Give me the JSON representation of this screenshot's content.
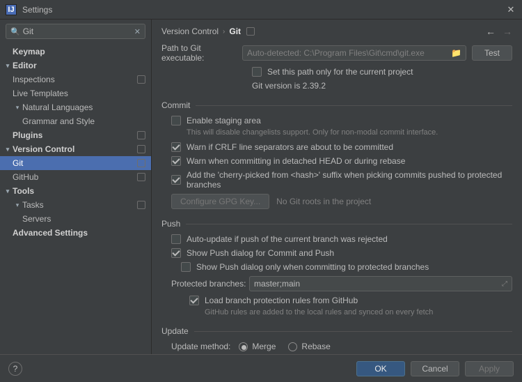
{
  "window": {
    "app_icon_text": "IJ",
    "title": "Settings"
  },
  "search": {
    "value": "Git"
  },
  "tree": [
    {
      "label": "Keymap",
      "level": 0,
      "expandable": false,
      "marker": false
    },
    {
      "label": "Editor",
      "level": 0,
      "expandable": true,
      "chev": "▾",
      "marker": false
    },
    {
      "label": "Inspections",
      "level": 1,
      "marker": true
    },
    {
      "label": "Live Templates",
      "level": 1,
      "marker": false
    },
    {
      "label": "Natural Languages",
      "level": 1,
      "expandable": true,
      "chev": "▾",
      "marker": false
    },
    {
      "label": "Grammar and Style",
      "level": 2,
      "marker": false
    },
    {
      "label": "Plugins",
      "level": 0,
      "expandable": false,
      "marker": true
    },
    {
      "label": "Version Control",
      "level": 0,
      "expandable": true,
      "chev": "▾",
      "marker": true
    },
    {
      "label": "Git",
      "level": 1,
      "selected": true,
      "marker": true
    },
    {
      "label": "GitHub",
      "level": 1,
      "marker": true
    },
    {
      "label": "Tools",
      "level": 0,
      "expandable": true,
      "chev": "▾",
      "marker": false
    },
    {
      "label": "Tasks",
      "level": 1,
      "expandable": true,
      "chev": "▾",
      "marker": true
    },
    {
      "label": "Servers",
      "level": 2,
      "marker": false
    },
    {
      "label": "Advanced Settings",
      "level": 0,
      "expandable": false,
      "marker": false
    }
  ],
  "breadcrumb": {
    "parent": "Version Control",
    "current": "Git"
  },
  "git": {
    "path_label": "Path to Git executable:",
    "path_value": "Auto-detected: C:\\Program Files\\Git\\cmd\\git.exe",
    "test_btn": "Test",
    "set_path_project_only": "Set this path only for the current project",
    "version_text": "Git version is 2.39.2"
  },
  "commit": {
    "header": "Commit",
    "enable_staging": "Enable staging area",
    "staging_help": "This will disable changelists support. Only for non-modal commit interface.",
    "warn_crlf": "Warn if CRLF line separators are about to be committed",
    "warn_detached": "Warn when committing in detached HEAD or during rebase",
    "cherry_suffix": "Add the 'cherry-picked from <hash>' suffix when picking commits pushed to protected branches",
    "gpg_btn": "Configure GPG Key...",
    "no_roots": "No Git roots in the project"
  },
  "push": {
    "header": "Push",
    "auto_update": "Auto-update if push of the current branch was rejected",
    "show_push_dialog": "Show Push dialog for Commit and Push",
    "show_push_protected": "Show Push dialog only when committing to protected branches",
    "protected_label": "Protected branches:",
    "protected_value": "master;main",
    "load_rules": "Load branch protection rules from GitHub",
    "load_rules_help": "GitHub rules are added to the local rules and synced on every fetch"
  },
  "update": {
    "header": "Update",
    "method_label": "Update method:",
    "merge": "Merge",
    "rebase": "Rebase"
  },
  "footer": {
    "ok": "OK",
    "cancel": "Cancel",
    "apply": "Apply"
  }
}
